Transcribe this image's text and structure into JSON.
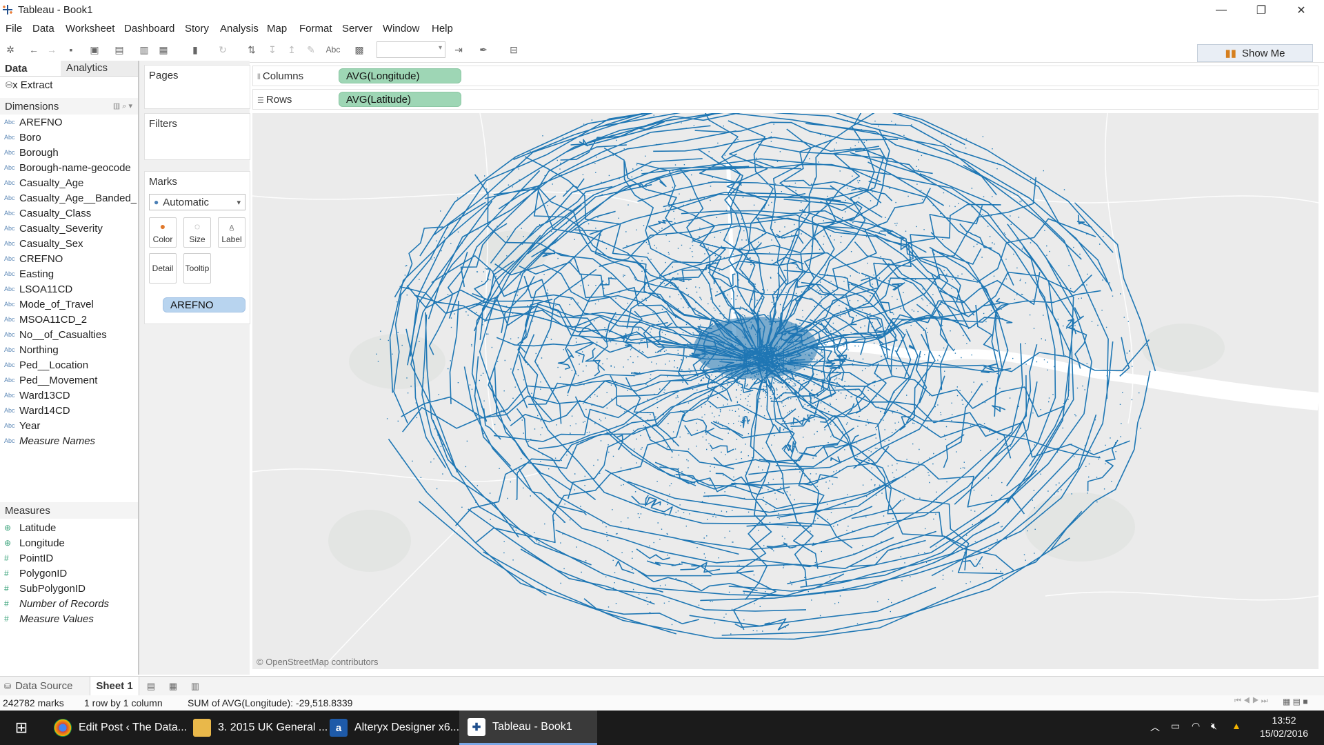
{
  "window": {
    "title": "Tableau - Book1",
    "minimize": "—",
    "restore": "❐",
    "close": "✕"
  },
  "menu": [
    "File",
    "Data",
    "Worksheet",
    "Dashboard",
    "Story",
    "Analysis",
    "Map",
    "Format",
    "Server",
    "Window",
    "Help"
  ],
  "toolbar": {
    "show_me": "Show Me",
    "abc_label": "Abc"
  },
  "data_pane": {
    "tabs": {
      "data": "Data",
      "analytics": "Analytics"
    },
    "datasource": "x Extract",
    "dimensions_header": "Dimensions",
    "dimensions": [
      "AREFNO",
      "Boro",
      "Borough",
      "Borough-name-geocode",
      "Casualty_Age",
      "Casualty_Age__Banded_",
      "Casualty_Class",
      "Casualty_Severity",
      "Casualty_Sex",
      "CREFNO",
      "Easting",
      "LSOA11CD",
      "Mode_of_Travel",
      "MSOA11CD_2",
      "No__of_Casualties",
      "Northing",
      "Ped__Location",
      "Ped__Movement",
      "Ward13CD",
      "Ward14CD",
      "Year",
      "Measure Names"
    ],
    "dimension_icon": "Abc",
    "measures_header": "Measures",
    "measures": [
      {
        "name": "Latitude",
        "icon": "globe-icon"
      },
      {
        "name": "Longitude",
        "icon": "globe-icon"
      },
      {
        "name": "PointID",
        "icon": "number-icon"
      },
      {
        "name": "PolygonID",
        "icon": "number-icon"
      },
      {
        "name": "SubPolygonID",
        "icon": "number-icon"
      },
      {
        "name": "Number of Records",
        "icon": "number-icon"
      },
      {
        "name": "Measure Values",
        "icon": "number-icon"
      }
    ]
  },
  "cards": {
    "pages": "Pages",
    "filters": "Filters",
    "marks": "Marks",
    "mark_type": "Automatic",
    "buttons": {
      "color": "Color",
      "size": "Size",
      "label": "Label",
      "detail": "Detail",
      "tooltip": "Tooltip"
    },
    "detail_pill": "AREFNO"
  },
  "shelves": {
    "columns_label": "Columns",
    "columns_pill": "AVG(Longitude)",
    "rows_label": "Rows",
    "rows_pill": "AVG(Latitude)"
  },
  "map": {
    "attribution": "© OpenStreetMap contributors",
    "mark_color": "#1f77b4"
  },
  "sheet_tabs": {
    "data_source": "Data Source",
    "sheet1": "Sheet 1"
  },
  "status": {
    "marks": "242782 marks",
    "dims": "1 row by 1 column",
    "sum": "SUM of AVG(Longitude): -29,518.8339"
  },
  "taskbar": {
    "tasks": [
      "Edit Post ‹ The Data...",
      "3. 2015 UK General ...",
      "Alteryx Designer x6...",
      "Tableau - Book1"
    ],
    "time": "13:52",
    "date": "15/02/2016"
  }
}
